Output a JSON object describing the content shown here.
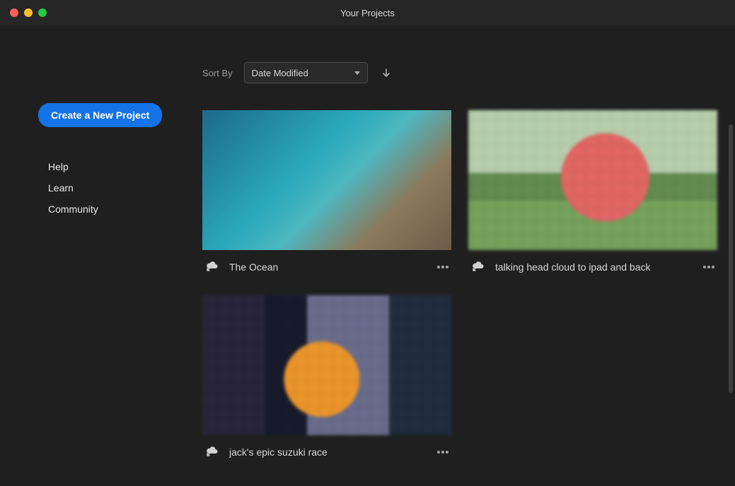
{
  "window": {
    "title": "Your Projects"
  },
  "sidebar": {
    "create_label": "Create a New Project",
    "links": [
      "Help",
      "Learn",
      "Community"
    ]
  },
  "sort": {
    "label": "Sort By",
    "selected": "Date Modified",
    "direction": "desc"
  },
  "projects": [
    {
      "title": "The Ocean",
      "icon": "cloud-sync-icon",
      "thumb_style": "thumb-gradient"
    },
    {
      "title": "talking head cloud to ipad and back",
      "icon": "cloud-sync-icon",
      "thumb_style": "thumb-pixel-red"
    },
    {
      "title": "jack's epic suzuki race",
      "icon": "cloud-sync-icon",
      "thumb_style": "thumb-pixel-orange"
    }
  ],
  "colors": {
    "accent": "#1473e6",
    "bg": "#1f1f1f",
    "titlebar": "#262626"
  }
}
